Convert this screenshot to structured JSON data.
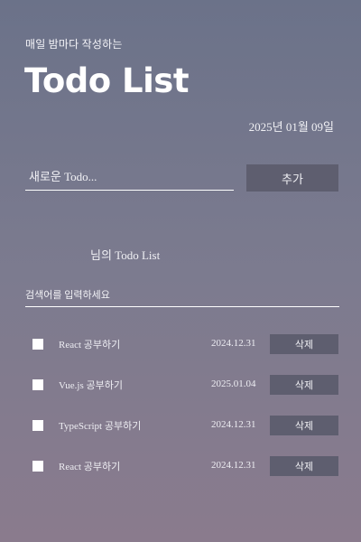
{
  "header": {
    "subtitle": "매일 밤마다 작성하는",
    "title": "Todo List",
    "date": "2025년 01월 09일"
  },
  "editor": {
    "placeholder": "새로운 Todo...",
    "add_label": "추가"
  },
  "list": {
    "heading": "님의 Todo List",
    "search_placeholder": "검색어를 입력하세요",
    "delete_label": "삭제",
    "items": [
      {
        "text": "React 공부하기",
        "date": "2024.12.31",
        "done": false
      },
      {
        "text": "Vue.js 공부하기",
        "date": "2025.01.04",
        "done": false
      },
      {
        "text": "TypeScript 공부하기",
        "date": "2024.12.31",
        "done": false
      },
      {
        "text": "React 공부하기",
        "date": "2024.12.31",
        "done": false
      }
    ]
  },
  "colors": {
    "background_top": "#6b7289",
    "background_bottom": "#8a7b8d",
    "button": "#5e5e6f",
    "text": "#ffffff"
  }
}
